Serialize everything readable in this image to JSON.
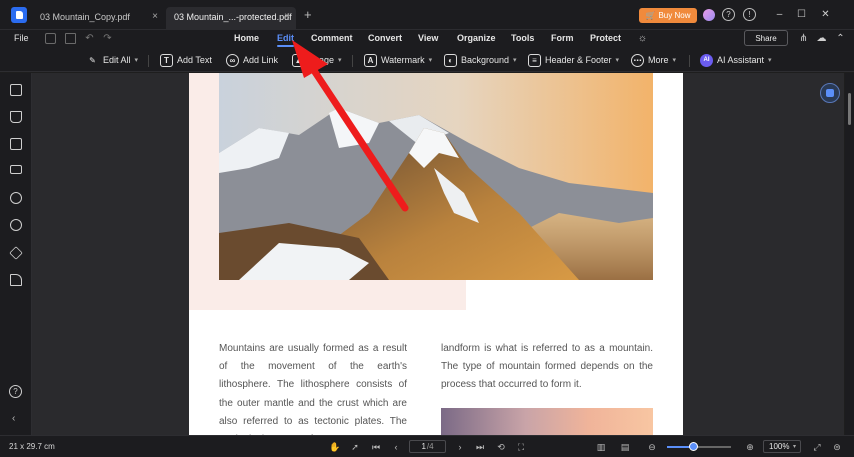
{
  "window": {
    "tabs": [
      {
        "label": "03 Mountain_Copy.pdf",
        "close": "×"
      },
      {
        "label": "03 Mountain_...-protected.pdf",
        "close": "×"
      }
    ],
    "new_tab": "+",
    "buy_now": "Buy Now"
  },
  "menu": {
    "file": "File",
    "items": [
      "Home",
      "Edit",
      "Comment",
      "Convert",
      "View",
      "Organize",
      "Tools",
      "Form",
      "Protect"
    ],
    "active": "Edit",
    "share": "Share"
  },
  "ribbon": {
    "edit_all": "Edit All",
    "add_text": "Add Text",
    "add_link": "Add Link",
    "image": "Image",
    "watermark": "Watermark",
    "background": "Background",
    "header_footer": "Header & Footer",
    "more": "More",
    "ai_assistant": "AI Assistant",
    "ai_badge": "AI"
  },
  "document": {
    "col1": "Mountains are usually formed as a result of the movement of the earth's lithosphere. The lithosphere consists of the outer mantle and the crust which are also referred to as tectonic plates. The geological process of",
    "col2": "landform is what is referred to as a mountain. The type of mountain formed depends on the process that occurred to form it."
  },
  "status": {
    "dimensions": "21 x 29.7 cm",
    "page_current": "1",
    "page_total": "/4",
    "zoom": "100%",
    "zoom_level": 0.42
  },
  "colors": {
    "accent": "#5b8ff9",
    "buy_now": "#f08a3c",
    "annotation_arrow": "#ee1c1c"
  }
}
